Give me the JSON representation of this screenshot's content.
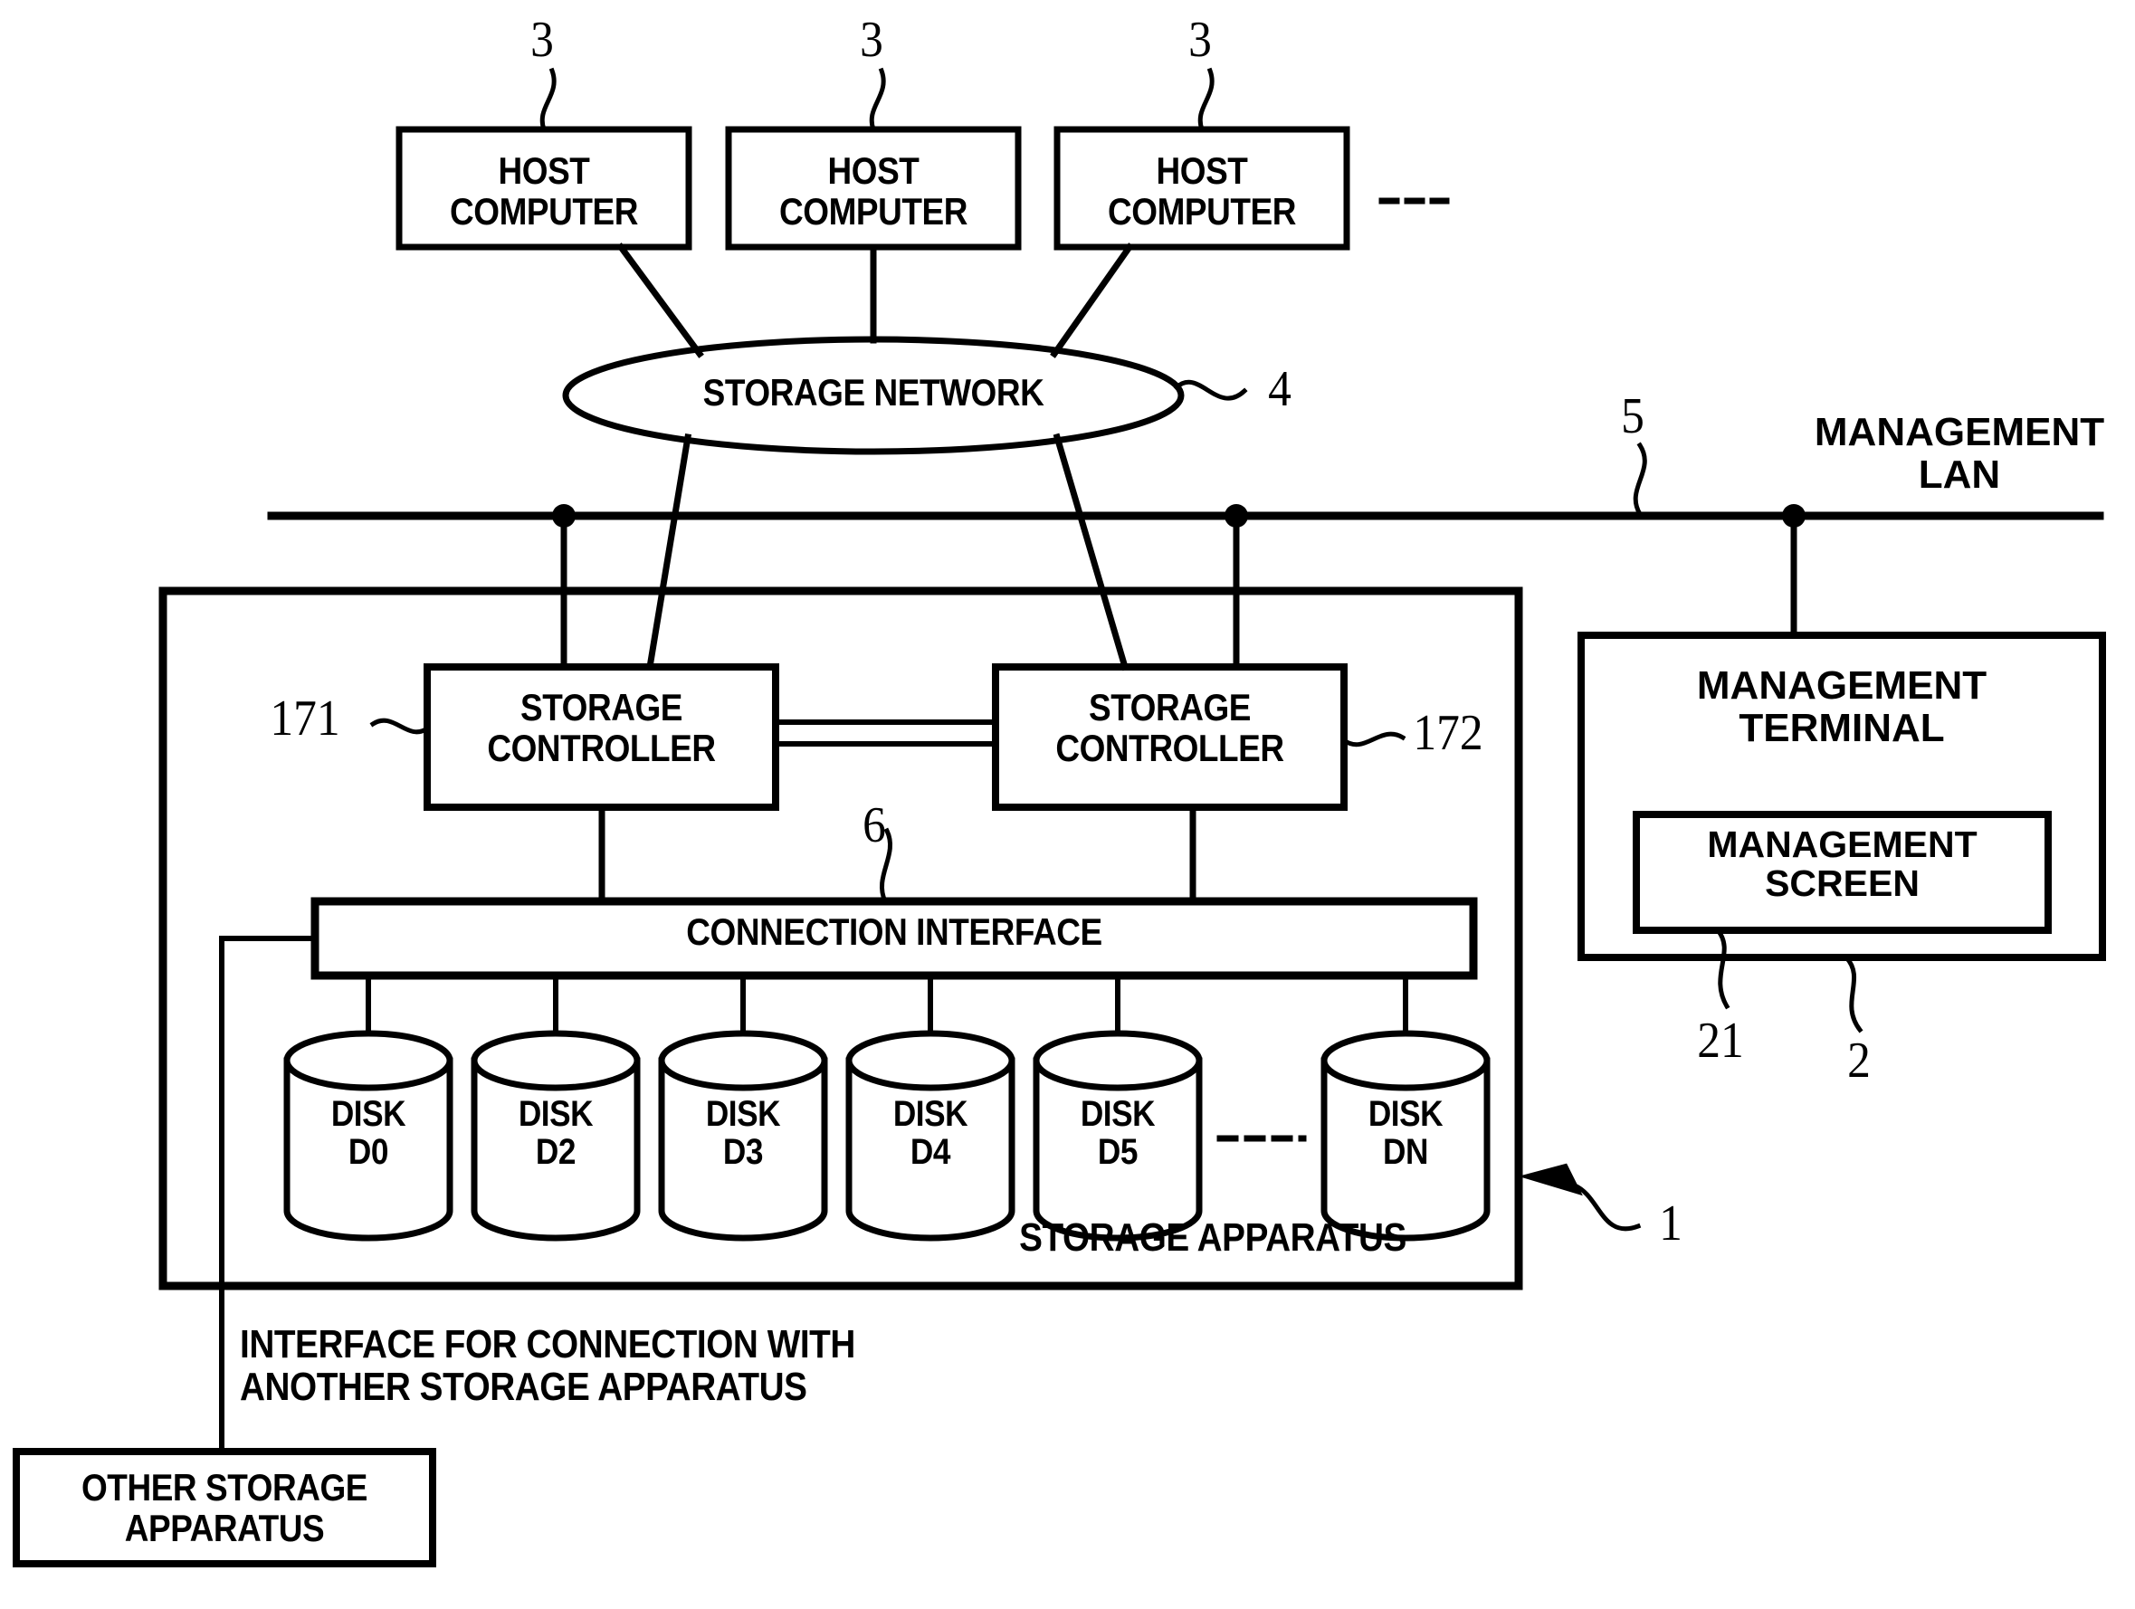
{
  "figure": {
    "type": "system-block-diagram",
    "domain": "patent-figure"
  },
  "hosts": [
    {
      "label": "HOST\nCOMPUTER",
      "ref": "3"
    },
    {
      "label": "HOST\nCOMPUTER",
      "ref": "3"
    },
    {
      "label": "HOST\nCOMPUTER",
      "ref": "3"
    }
  ],
  "host_ellipsis": "-----",
  "network": {
    "label": "STORAGE NETWORK",
    "ref": "4"
  },
  "management_lan": {
    "label": "MANAGEMENT\nLAN",
    "ref": "5"
  },
  "controllers": [
    {
      "label": "STORAGE\nCONTROLLER",
      "ref": "171"
    },
    {
      "label": "STORAGE\nCONTROLLER",
      "ref": "172"
    }
  ],
  "connection_interface": {
    "label": "CONNECTION INTERFACE",
    "ref": "6"
  },
  "disks": [
    {
      "label": "DISK\nD0"
    },
    {
      "label": "DISK\nD2"
    },
    {
      "label": "DISK\nD3"
    },
    {
      "label": "DISK\nD4"
    },
    {
      "label": "DISK\nD5"
    },
    {
      "label": "DISK\nDN"
    }
  ],
  "disk_ellipsis": "-----",
  "storage_apparatus": {
    "label": "STORAGE APPARATUS",
    "ref": "1"
  },
  "management_terminal": {
    "label": "MANAGEMENT\nTERMINAL",
    "ref": "2",
    "screen": {
      "label": "MANAGEMENT\nSCREEN",
      "ref": "21"
    }
  },
  "external_interface": {
    "caption": "INTERFACE FOR CONNECTION WITH\nANOTHER STORAGE APPARATUS",
    "other_apparatus_label": "OTHER STORAGE\nAPPARATUS"
  },
  "colors": {
    "stroke": "#000000",
    "background": "#ffffff"
  }
}
